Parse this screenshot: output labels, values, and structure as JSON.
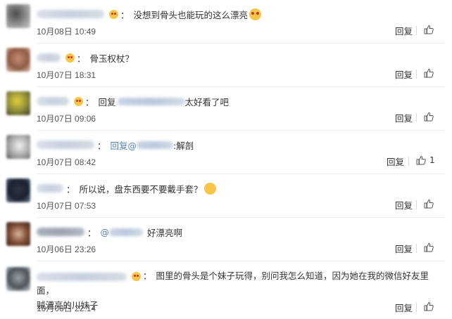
{
  "reply_label": "回复",
  "comments": [
    {
      "text": "没想到骨头也能玩的这么漂亮",
      "date": "10月08日",
      "time": "10:49",
      "likes": ""
    },
    {
      "text": "骨玉权杖？",
      "date": "10月07日",
      "time": "18:31",
      "likes": ""
    },
    {
      "prefix": "回复",
      "text": "太好看了吧",
      "date": "10月07日",
      "time": "09:06",
      "likes": ""
    },
    {
      "prefix": "回复@",
      "text": ":解剖",
      "date": "10月07日",
      "time": "08:42",
      "likes": "1"
    },
    {
      "text": "所以说，盘东西要不要戴手套？",
      "date": "10月07日",
      "time": "07:53",
      "likes": ""
    },
    {
      "prefix": "@",
      "text": "好漂亮啊",
      "date": "10月06日",
      "time": "23:26",
      "likes": ""
    },
    {
      "text_line1": "图里的骨头是个妹子玩得，别问我怎么知道，因为她在我的微信好友里面，",
      "text_line2": "贼漂亮的川妹子",
      "date": "10月06日",
      "time": "22:14",
      "likes": ""
    }
  ]
}
